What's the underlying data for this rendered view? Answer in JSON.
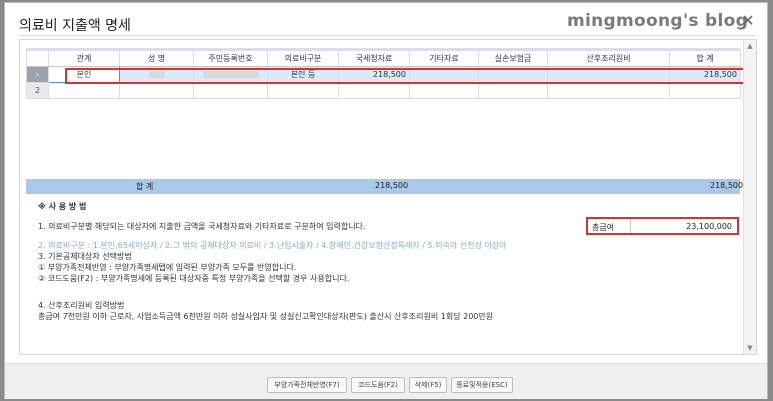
{
  "dialog": {
    "title": "의료비 지출액 명세",
    "watermark": "mingmoong's blog",
    "close_glyph": "✕"
  },
  "table": {
    "columns": [
      "관계",
      "성 명",
      "주민등록번호",
      "의료비구분",
      "국세청자료",
      "기타자료",
      "실손보험금",
      "산후조리원비",
      "합 계"
    ],
    "rows": [
      {
        "marker": "›",
        "relation": "본인",
        "medical_type": "본인 등",
        "nts_amount": "218,500",
        "total": "218,500"
      },
      {
        "marker": "2"
      }
    ],
    "sum_label": "합        계",
    "sum_nts": "218,500",
    "sum_total": "218,500"
  },
  "usage": {
    "heading": "※ 사 용 방 법",
    "line1": "1. 의료비구분별 해당되는 대상자에 지출한 금액을 국세청자료와 기타자료로 구분하여 입력합니다.",
    "line2": "2. 의료비구분 : 1.본인,65세이상자 / 2.그 밖의 공제대상자 의료비 / 3.난임시술자 / 4.장애인,건강보험산정특례자 / 5.미숙아 선천성 이상아",
    "line3": "3. 기본공제대상자 선택방법",
    "line3a": "① 부양가족전체반영 : 부양가족명세탭에 입력된 부양가족 모두를 반영합니다.",
    "line3b": "② 코드도움(F2) : 부양가족명세에 등록된 대상자중 특정 부양가족을 선택할 경우 사용합니다.",
    "line4": "4. 산후조리원비 입력방법",
    "line4a": "총급여 7천만원 이하 근로자, 사업소득금액 6천만원 이하 성실사업자 및 성실신고확인대상자(판도) 출산시 산후조리원비 1회당 200만원"
  },
  "total_pay": {
    "label": "총급여",
    "value": "23,100,000"
  },
  "buttons": {
    "apply_family": "부양가족전체반영(F7)",
    "code_help": "코드도움(F2)",
    "delete": "삭제(F5)",
    "close_apply": "종료및적용(ESC)"
  },
  "colors": {
    "highlight": "#d93030",
    "selected_row": "#dbe9f8",
    "sum_row": "#a9c9ea"
  }
}
